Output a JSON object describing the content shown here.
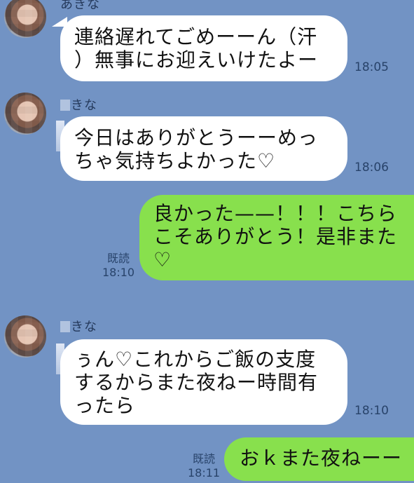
{
  "contact": {
    "name": "あきな",
    "name_partial": "きな"
  },
  "messages": [
    {
      "id": "m1",
      "side": "left",
      "lines": [
        "連絡遅れてごめーーん（汗",
        "）無事にお迎えいけたよー"
      ],
      "time": "18:05"
    },
    {
      "id": "m2",
      "side": "left",
      "lines": [
        "今日はありがとうーーめっ",
        "ちゃ気持ちよかった♡"
      ],
      "time": "18:06"
    },
    {
      "id": "m3",
      "side": "right",
      "lines": [
        "良かった——！！！こちら",
        "こそありがとう！是非また",
        "♡"
      ],
      "read": "既読",
      "time": "18:10"
    },
    {
      "id": "m4",
      "side": "left",
      "lines": [
        "ぅん♡これからご飯の支度",
        "するからまた夜ねー時間有",
        "ったら"
      ],
      "time": "18:10"
    },
    {
      "id": "m5",
      "side": "right",
      "lines": [
        "おｋまた夜ねーー"
      ],
      "read": "既読",
      "time": "18:11"
    }
  ],
  "colors": {
    "background": "#7293c4",
    "incoming_bubble": "#ffffff",
    "outgoing_bubble": "#88e04d",
    "meta_text": "#28436a"
  }
}
